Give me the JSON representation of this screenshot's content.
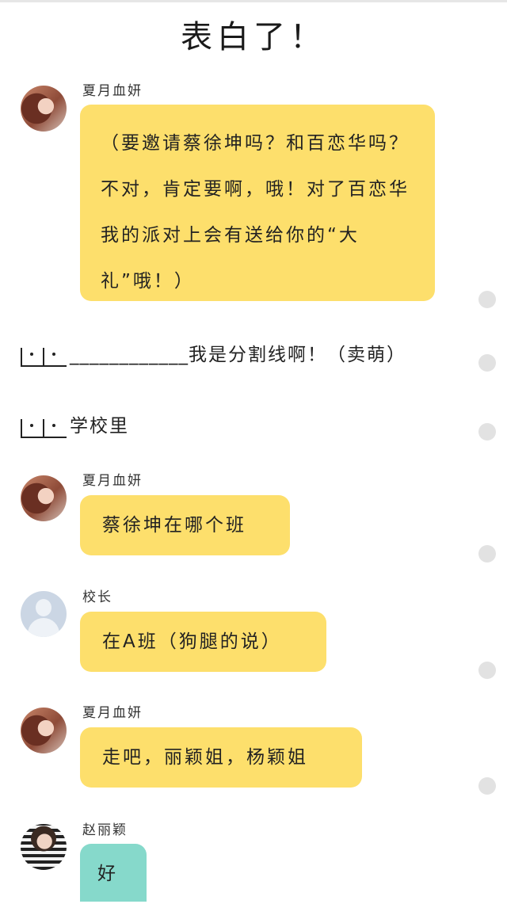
{
  "title": "表白了！",
  "messages": [
    {
      "sender": "夏月血妍",
      "text": "（要邀请蔡徐坤吗？和百恋华吗？不对，肯定要啊，哦！对了百恋华我的派对上会有送给你的“大礼”哦！）"
    },
    {
      "sender": "夏月血妍",
      "text": "蔡徐坤在哪个班"
    },
    {
      "sender": "校长",
      "text": "在A班（狗腿的说）"
    },
    {
      "sender": "夏月血妍",
      "text": "走吧，丽颖姐，杨颖姐"
    },
    {
      "sender": "赵丽颖",
      "text": "好"
    }
  ],
  "narration": {
    "divider_dashes": "____________",
    "divider_text": "我是分割线啊！（卖萌）",
    "scene_text": "学校里"
  },
  "colors": {
    "bubble_yellow": "#fddf6c",
    "bubble_teal": "#86d9cb"
  }
}
